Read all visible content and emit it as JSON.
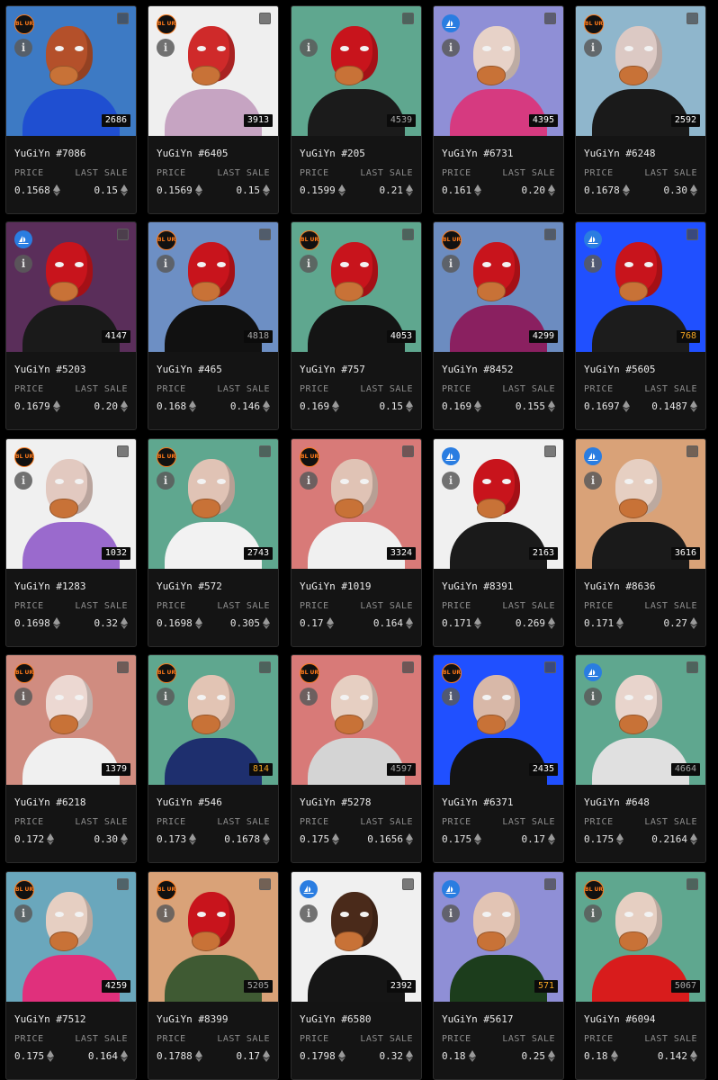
{
  "labels": {
    "price": "PRICE",
    "last_sale": "LAST SALE"
  },
  "colors": {
    "card_bg": "#141414",
    "card_border": "#2b2b2b",
    "label_gray": "#8e8e8e",
    "blur_orange": "#ff7a1a",
    "opensea_blue": "#2a7de1",
    "rank_gold": "#f5a623"
  },
  "icons": {
    "marketplace_blur": "blur-marketplace-icon",
    "marketplace_opensea": "opensea-icon",
    "info": "info-icon",
    "currency": "ethereum-icon",
    "select": "checkbox"
  },
  "marketplace_text": {
    "blur": "BL UR"
  },
  "cards": [
    {
      "name": "YuGiYn #7086",
      "price": "0.1568",
      "last_sale": "0.15",
      "rank": "2686",
      "rank_style": "white",
      "marketplace": "blur",
      "bg": "#3d7ac4",
      "skin": "#b4502a",
      "outfit": "#1f4fd1"
    },
    {
      "name": "YuGiYn #6405",
      "price": "0.1569",
      "last_sale": "0.15",
      "rank": "3913",
      "rank_style": "white",
      "marketplace": "blur",
      "bg": "#efefef",
      "skin": "#cf2a2a",
      "outfit": "#c6a4c2"
    },
    {
      "name": "YuGiYn #205",
      "price": "0.1599",
      "last_sale": "0.21",
      "rank": "4539",
      "rank_style": "dim",
      "marketplace": "none",
      "bg": "#5fa78f",
      "skin": "#c8141c",
      "outfit": "#1b1b1b"
    },
    {
      "name": "YuGiYn #6731",
      "price": "0.161",
      "last_sale": "0.20",
      "rank": "4395",
      "rank_style": "white",
      "marketplace": "opensea",
      "bg": "#8f8fd6",
      "skin": "#e7d2c8",
      "outfit": "#d63a80"
    },
    {
      "name": "YuGiYn #6248",
      "price": "0.1678",
      "last_sale": "0.30",
      "rank": "2592",
      "rank_style": "white",
      "marketplace": "blur",
      "bg": "#8fb6cc",
      "skin": "#dcc9c4",
      "outfit": "#1a1a1a"
    },
    {
      "name": "YuGiYn #5203",
      "price": "0.1679",
      "last_sale": "0.20",
      "rank": "4147",
      "rank_style": "white",
      "marketplace": "opensea",
      "bg": "#5a2e5a",
      "skin": "#c8141c",
      "outfit": "#1a1a1a"
    },
    {
      "name": "YuGiYn #465",
      "price": "0.168",
      "last_sale": "0.146",
      "rank": "4818",
      "rank_style": "dim",
      "marketplace": "blur",
      "bg": "#6d8fc4",
      "skin": "#c8141c",
      "outfit": "#111111"
    },
    {
      "name": "YuGiYn #757",
      "price": "0.169",
      "last_sale": "0.15",
      "rank": "4053",
      "rank_style": "white",
      "marketplace": "blur",
      "bg": "#5fa78f",
      "skin": "#c8141c",
      "outfit": "#141414"
    },
    {
      "name": "YuGiYn #8452",
      "price": "0.169",
      "last_sale": "0.155",
      "rank": "4299",
      "rank_style": "white",
      "marketplace": "blur",
      "bg": "#6c8cc0",
      "skin": "#c8141c",
      "outfit": "#8a2060"
    },
    {
      "name": "YuGiYn #5605",
      "price": "0.1697",
      "last_sale": "0.1487",
      "rank": "768",
      "rank_style": "gold",
      "marketplace": "opensea",
      "bg": "#2050ff",
      "skin": "#c8141c",
      "outfit": "#1c1c1c"
    },
    {
      "name": "YuGiYn #1283",
      "price": "0.1698",
      "last_sale": "0.32",
      "rank": "1032",
      "rank_style": "white",
      "marketplace": "blur",
      "bg": "#f0f0f0",
      "skin": "#e2c9c0",
      "outfit": "#9a6acd"
    },
    {
      "name": "YuGiYn #572",
      "price": "0.1698",
      "last_sale": "0.305",
      "rank": "2743",
      "rank_style": "white",
      "marketplace": "blur",
      "bg": "#5fa78f",
      "skin": "#e0c3b5",
      "outfit": "#f2f2f2"
    },
    {
      "name": "YuGiYn #1019",
      "price": "0.17",
      "last_sale": "0.164",
      "rank": "3324",
      "rank_style": "white",
      "marketplace": "blur",
      "bg": "#d87a78",
      "skin": "#e0c3b5",
      "outfit": "#f0f0f0"
    },
    {
      "name": "YuGiYn #8391",
      "price": "0.171",
      "last_sale": "0.269",
      "rank": "2163",
      "rank_style": "white",
      "marketplace": "opensea",
      "bg": "#f0f0f0",
      "skin": "#c8141c",
      "outfit": "#1a1a1a"
    },
    {
      "name": "YuGiYn #8636",
      "price": "0.171",
      "last_sale": "0.27",
      "rank": "3616",
      "rank_style": "white",
      "marketplace": "opensea",
      "bg": "#d9a278",
      "skin": "#e6cfc2",
      "outfit": "#1a1a1a"
    },
    {
      "name": "YuGiYn #6218",
      "price": "0.172",
      "last_sale": "0.30",
      "rank": "1379",
      "rank_style": "white",
      "marketplace": "blur",
      "bg": "#d08c80",
      "skin": "#ecd8d2",
      "outfit": "#f0f0f0"
    },
    {
      "name": "YuGiYn #546",
      "price": "0.173",
      "last_sale": "0.1678",
      "rank": "814",
      "rank_style": "gold",
      "marketplace": "blur",
      "bg": "#5fa78f",
      "skin": "#e2c4b4",
      "outfit": "#1e2f6e"
    },
    {
      "name": "YuGiYn #5278",
      "price": "0.175",
      "last_sale": "0.1656",
      "rank": "4597",
      "rank_style": "dim",
      "marketplace": "blur",
      "bg": "#d87a78",
      "skin": "#e6cfc2",
      "outfit": "#d4d4d4"
    },
    {
      "name": "YuGiYn #6371",
      "price": "0.175",
      "last_sale": "0.17",
      "rank": "2435",
      "rank_style": "white",
      "marketplace": "blur",
      "bg": "#2050ff",
      "skin": "#d8b8a8",
      "outfit": "#141414"
    },
    {
      "name": "YuGiYn #648",
      "price": "0.175",
      "last_sale": "0.2164",
      "rank": "4664",
      "rank_style": "dim",
      "marketplace": "opensea",
      "bg": "#5fa78f",
      "skin": "#e8d4cc",
      "outfit": "#e0e0e0"
    },
    {
      "name": "YuGiYn #7512",
      "price": "0.175",
      "last_sale": "0.164",
      "rank": "4259",
      "rank_style": "white",
      "marketplace": "blur",
      "bg": "#6aa7bc",
      "skin": "#e6cfc2",
      "outfit": "#e0307c"
    },
    {
      "name": "YuGiYn #8399",
      "price": "0.1788",
      "last_sale": "0.17",
      "rank": "5205",
      "rank_style": "dim",
      "marketplace": "blur",
      "bg": "#d9a278",
      "skin": "#c8141c",
      "outfit": "#3f5a33"
    },
    {
      "name": "YuGiYn #6580",
      "price": "0.1798",
      "last_sale": "0.32",
      "rank": "2392",
      "rank_style": "white",
      "marketplace": "opensea",
      "bg": "#f0f0f0",
      "skin": "#4a2a1a",
      "outfit": "#151515"
    },
    {
      "name": "YuGiYn #5617",
      "price": "0.18",
      "last_sale": "0.25",
      "rank": "571",
      "rank_style": "gold",
      "marketplace": "opensea",
      "bg": "#8f8fd6",
      "skin": "#e2c4b4",
      "outfit": "#1c3d1c"
    },
    {
      "name": "YuGiYn #6094",
      "price": "0.18",
      "last_sale": "0.142",
      "rank": "5067",
      "rank_style": "dim",
      "marketplace": "blur",
      "bg": "#5fa78f",
      "skin": "#e6cfc2",
      "outfit": "#d81c1c"
    }
  ]
}
